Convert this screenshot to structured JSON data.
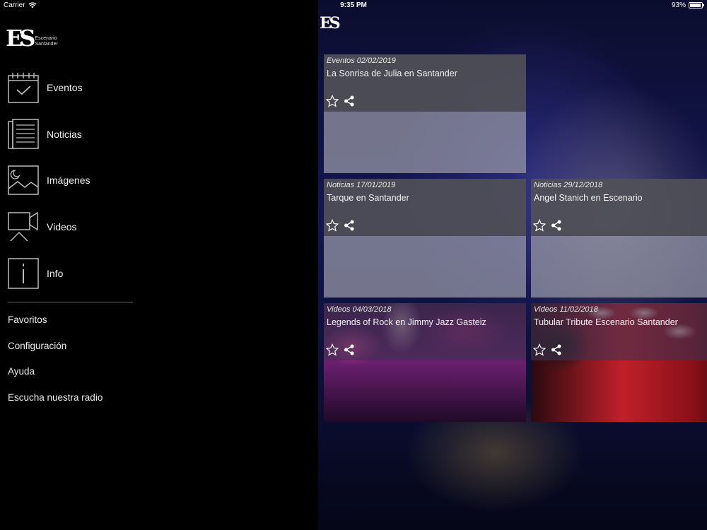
{
  "status_bar": {
    "carrier": "Carrier",
    "time": "9:35 PM",
    "battery": "93%",
    "battery_level": 0.93
  },
  "app": {
    "logo_mark": "ES",
    "logo_line1": "Escenario",
    "logo_line2": "Santander"
  },
  "menu": {
    "items": [
      {
        "label": "Eventos",
        "icon": "calendar-icon"
      },
      {
        "label": "Noticias",
        "icon": "newspaper-icon"
      },
      {
        "label": "Imágenes",
        "icon": "image-icon"
      },
      {
        "label": "Videos",
        "icon": "video-camera-icon"
      },
      {
        "label": "Info",
        "icon": "info-icon"
      }
    ],
    "links": [
      {
        "label": "Favoritos"
      },
      {
        "label": "Configuración"
      },
      {
        "label": "Ayuda"
      },
      {
        "label": "Escucha nuestra radio"
      }
    ]
  },
  "content": {
    "logo_mark": "ES",
    "cards": [
      {
        "meta": "Eventos 02/02/2019",
        "title": "La Sonrisa de Julia en Santander",
        "media": "none"
      },
      {
        "meta": "Noticias 17/01/2019",
        "title": "Tarque en Santander",
        "media": "none"
      },
      {
        "meta": "Noticias 29/12/2018",
        "title": "Angel Stanich en Escenario",
        "media": "none"
      },
      {
        "meta": "Videos 04/03/2018",
        "title": "Legends of Rock en Jimmy Jazz Gasteiz",
        "media": "photo"
      },
      {
        "meta": "Videos 11/02/2018",
        "title": "Tubular Tribute Escenario Santander",
        "media": "photo"
      }
    ]
  },
  "colors": {
    "menu_bg": "#000000",
    "card_header": "#505058",
    "card_placeholder": "#9696a5"
  }
}
